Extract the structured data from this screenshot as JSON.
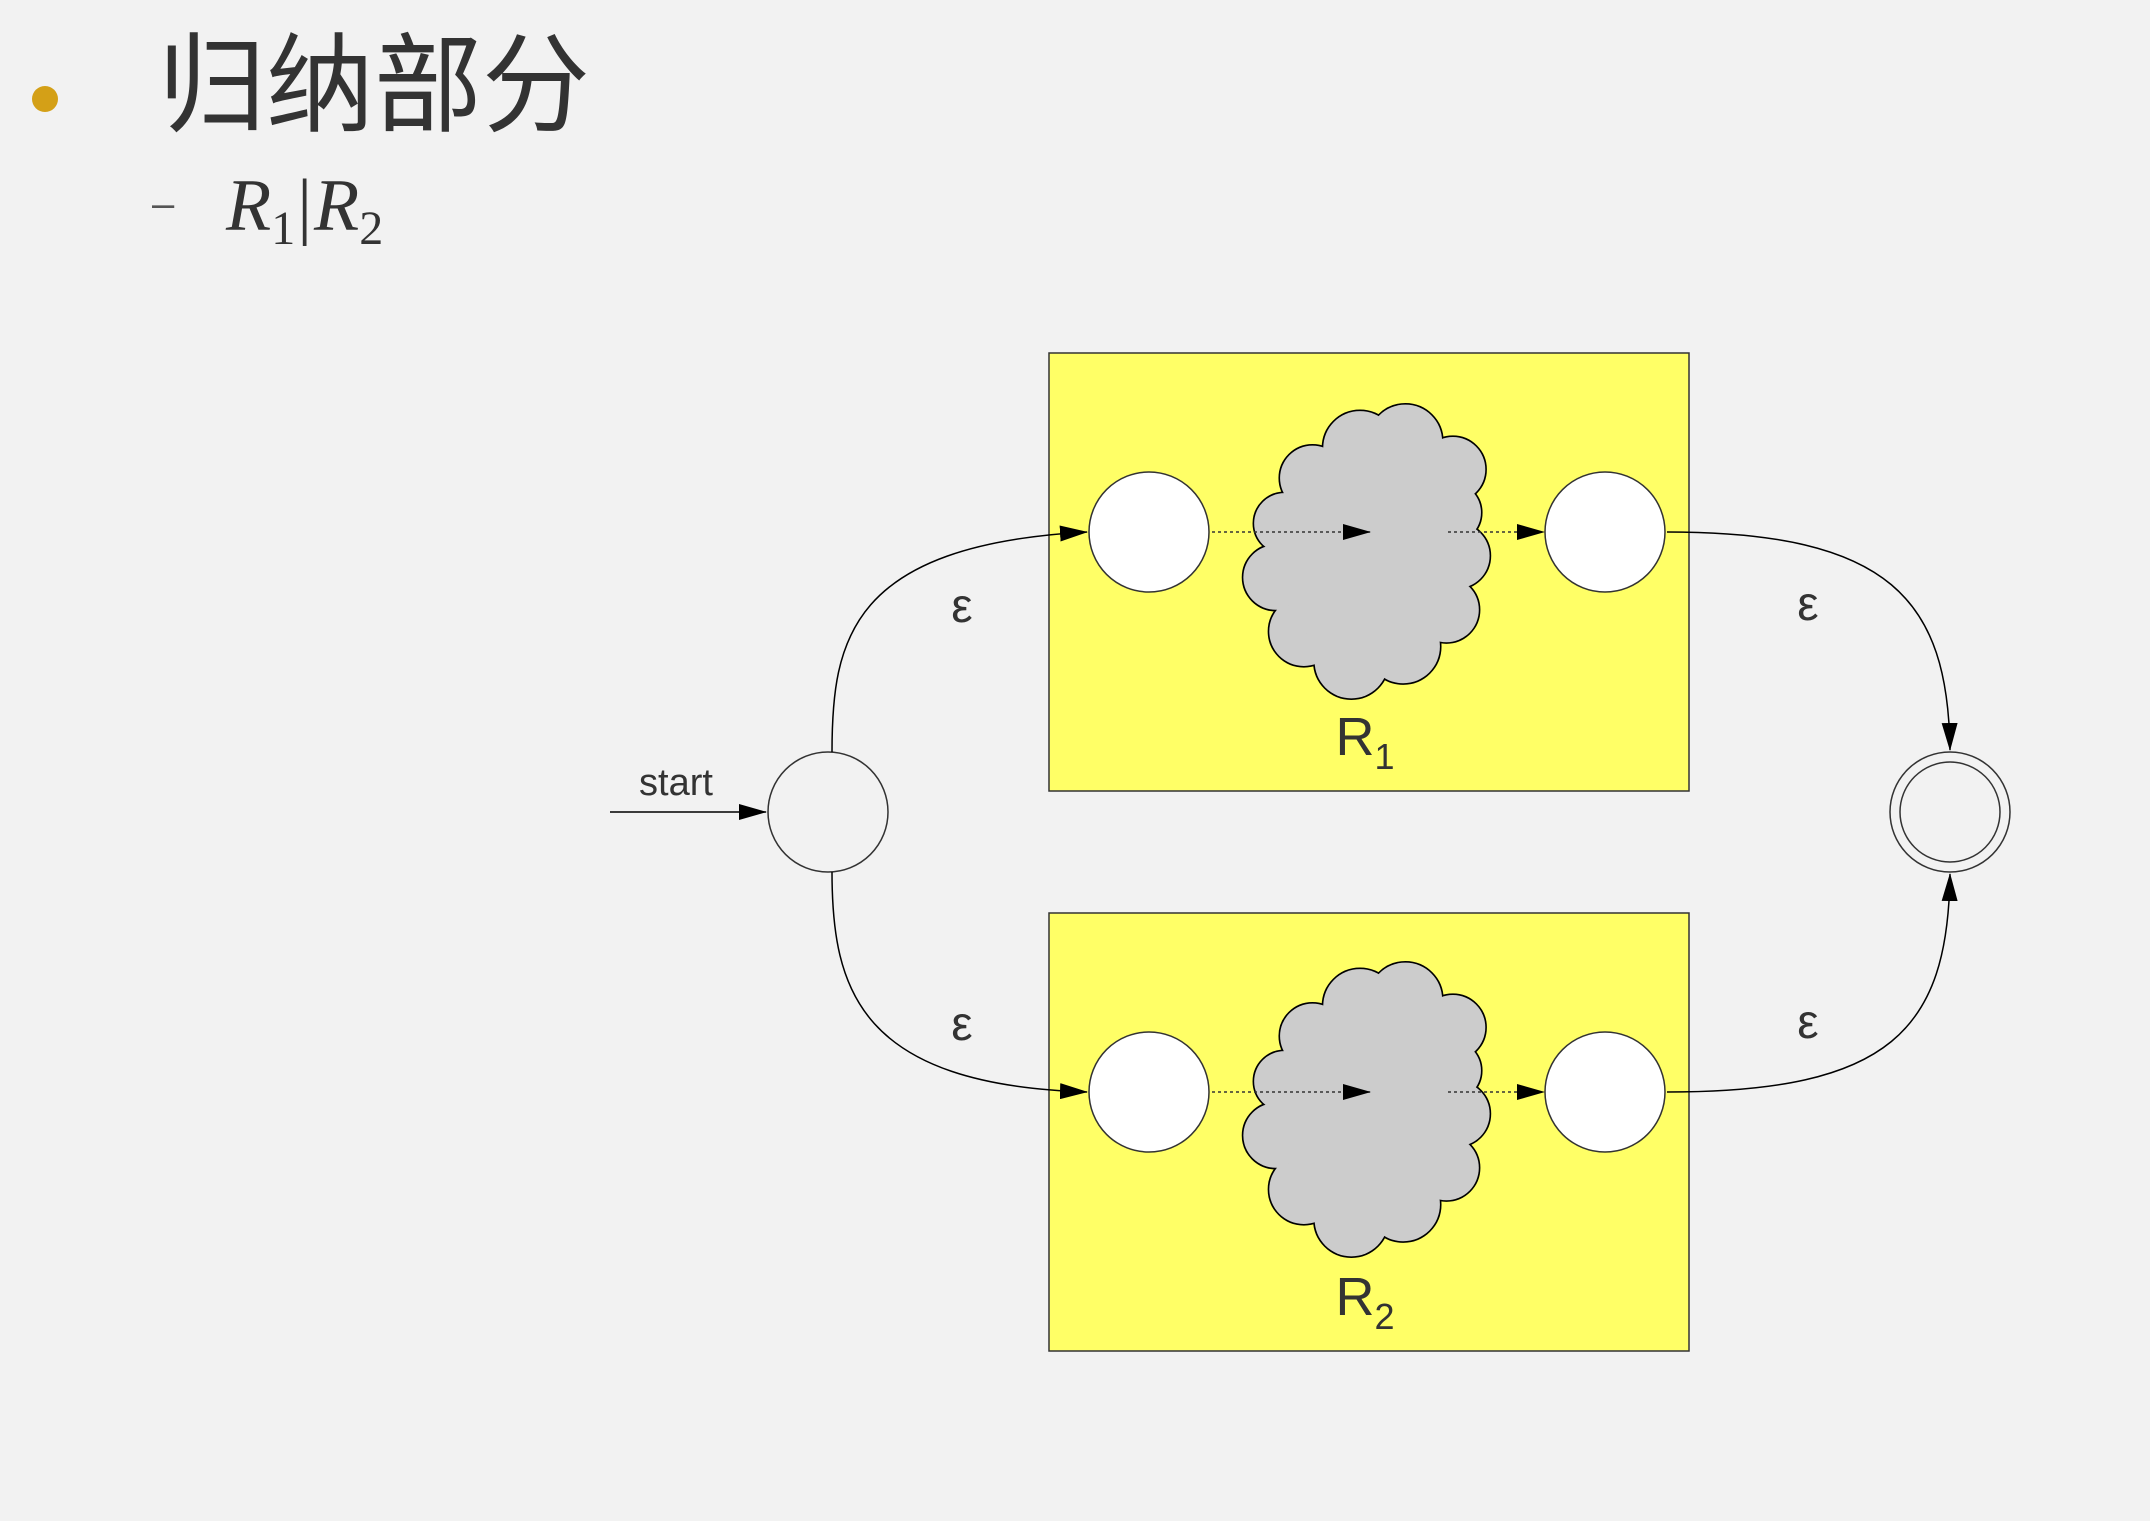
{
  "slide": {
    "title": "归纳部分",
    "subitem": {
      "r1": "R",
      "r1_sub": "1",
      "separator": "|",
      "r2": "R",
      "r2_sub": "2"
    },
    "accent_color": "#d4a017"
  },
  "diagram": {
    "start_label": "start",
    "epsilon": "ε",
    "box1": {
      "label": "R",
      "subscript": "1"
    },
    "box2": {
      "label": "R",
      "subscript": "2"
    },
    "colors": {
      "box_fill": "#ffff66",
      "cloud_fill": "#cccccc",
      "state_fill": "#ffffff",
      "line": "#000000"
    }
  }
}
